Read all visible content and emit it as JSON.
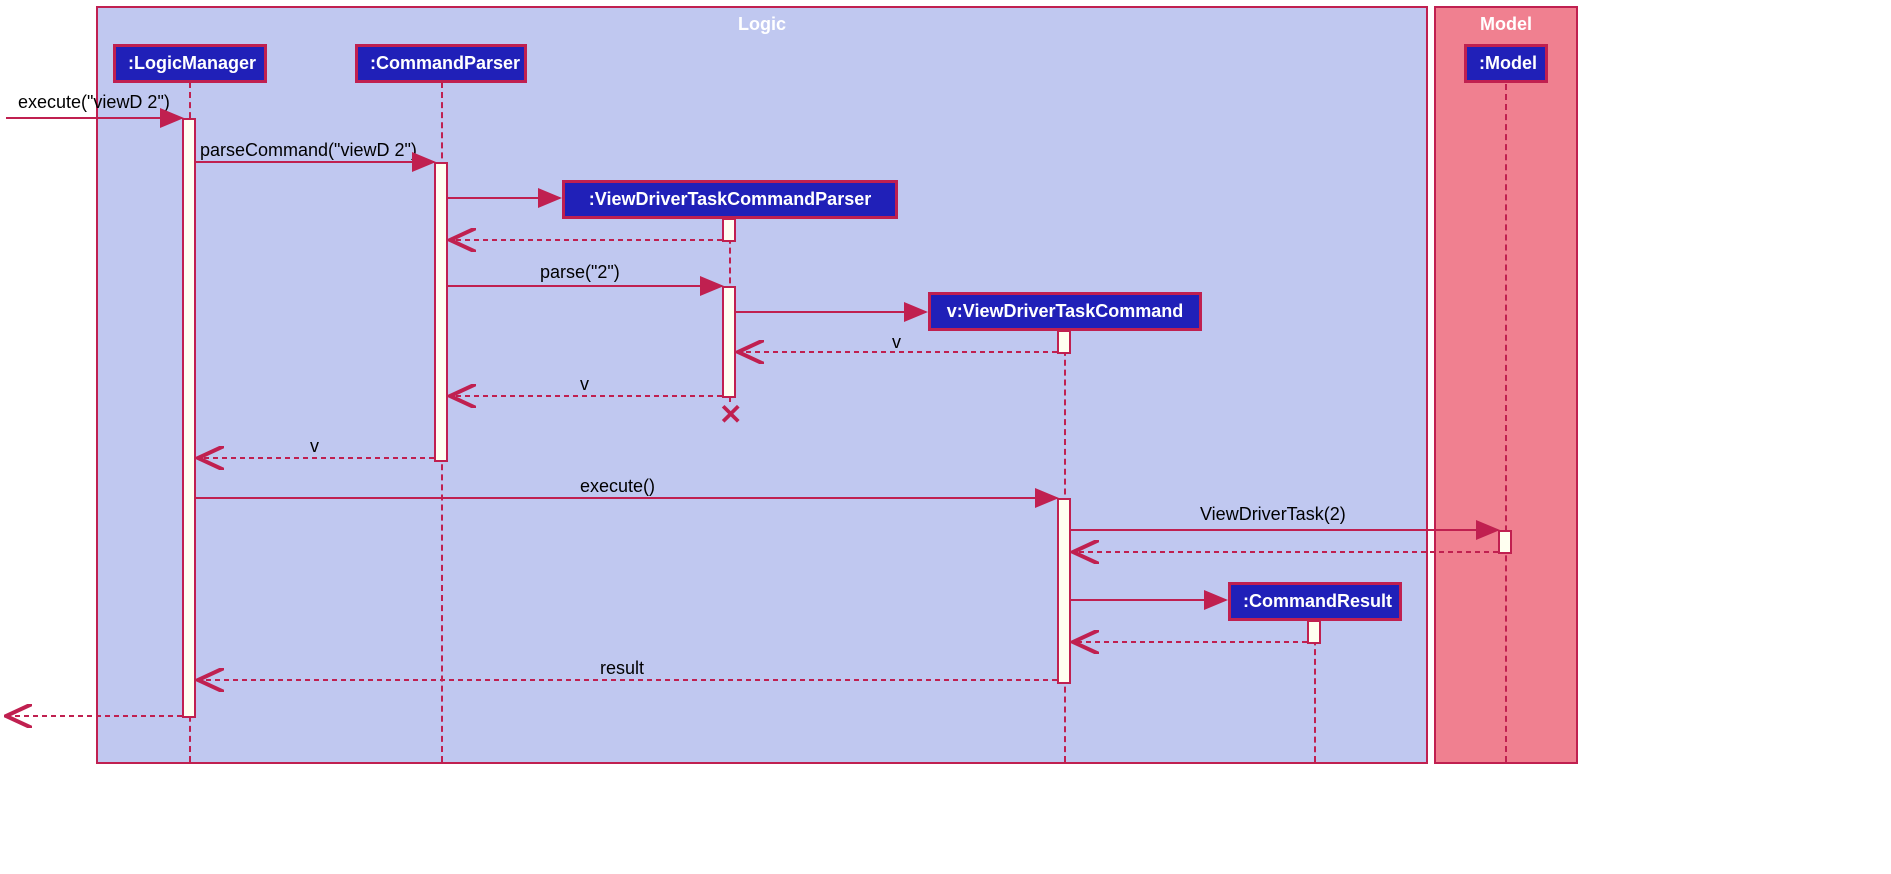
{
  "frames": {
    "logic": {
      "title": "Logic"
    },
    "model": {
      "title": "Model"
    }
  },
  "participants": {
    "logicManager": {
      "label": ":LogicManager"
    },
    "commandParser": {
      "label": ":CommandParser"
    },
    "viewDriverTaskCommandParser": {
      "label": ":ViewDriverTaskCommandParser"
    },
    "viewDriverTaskCommand": {
      "label": "v:ViewDriverTaskCommand"
    },
    "commandResult": {
      "label": ":CommandResult"
    },
    "model": {
      "label": ":Model"
    }
  },
  "messages": {
    "m1": {
      "label": "execute(\"viewD 2\")"
    },
    "m2": {
      "label": "parseCommand(\"viewD 2\")"
    },
    "m3": {
      "label": ""
    },
    "m4": {
      "label": ""
    },
    "m5": {
      "label": "parse(\"2\")"
    },
    "m6": {
      "label": ""
    },
    "m7": {
      "label": "v"
    },
    "m8": {
      "label": "v"
    },
    "m9": {
      "label": "v"
    },
    "m10": {
      "label": "execute()"
    },
    "m11": {
      "label": "ViewDriverTask(2)"
    },
    "m12": {
      "label": ""
    },
    "m13": {
      "label": ""
    },
    "m14": {
      "label": ""
    },
    "m15": {
      "label": "result"
    },
    "m16": {
      "label": ""
    }
  },
  "colors": {
    "frameBorder": "#c02050",
    "logicBg": "#c0c8f0",
    "modelBg": "#f08090",
    "boxBg": "#2020b8",
    "lifeline": "#c02050"
  }
}
